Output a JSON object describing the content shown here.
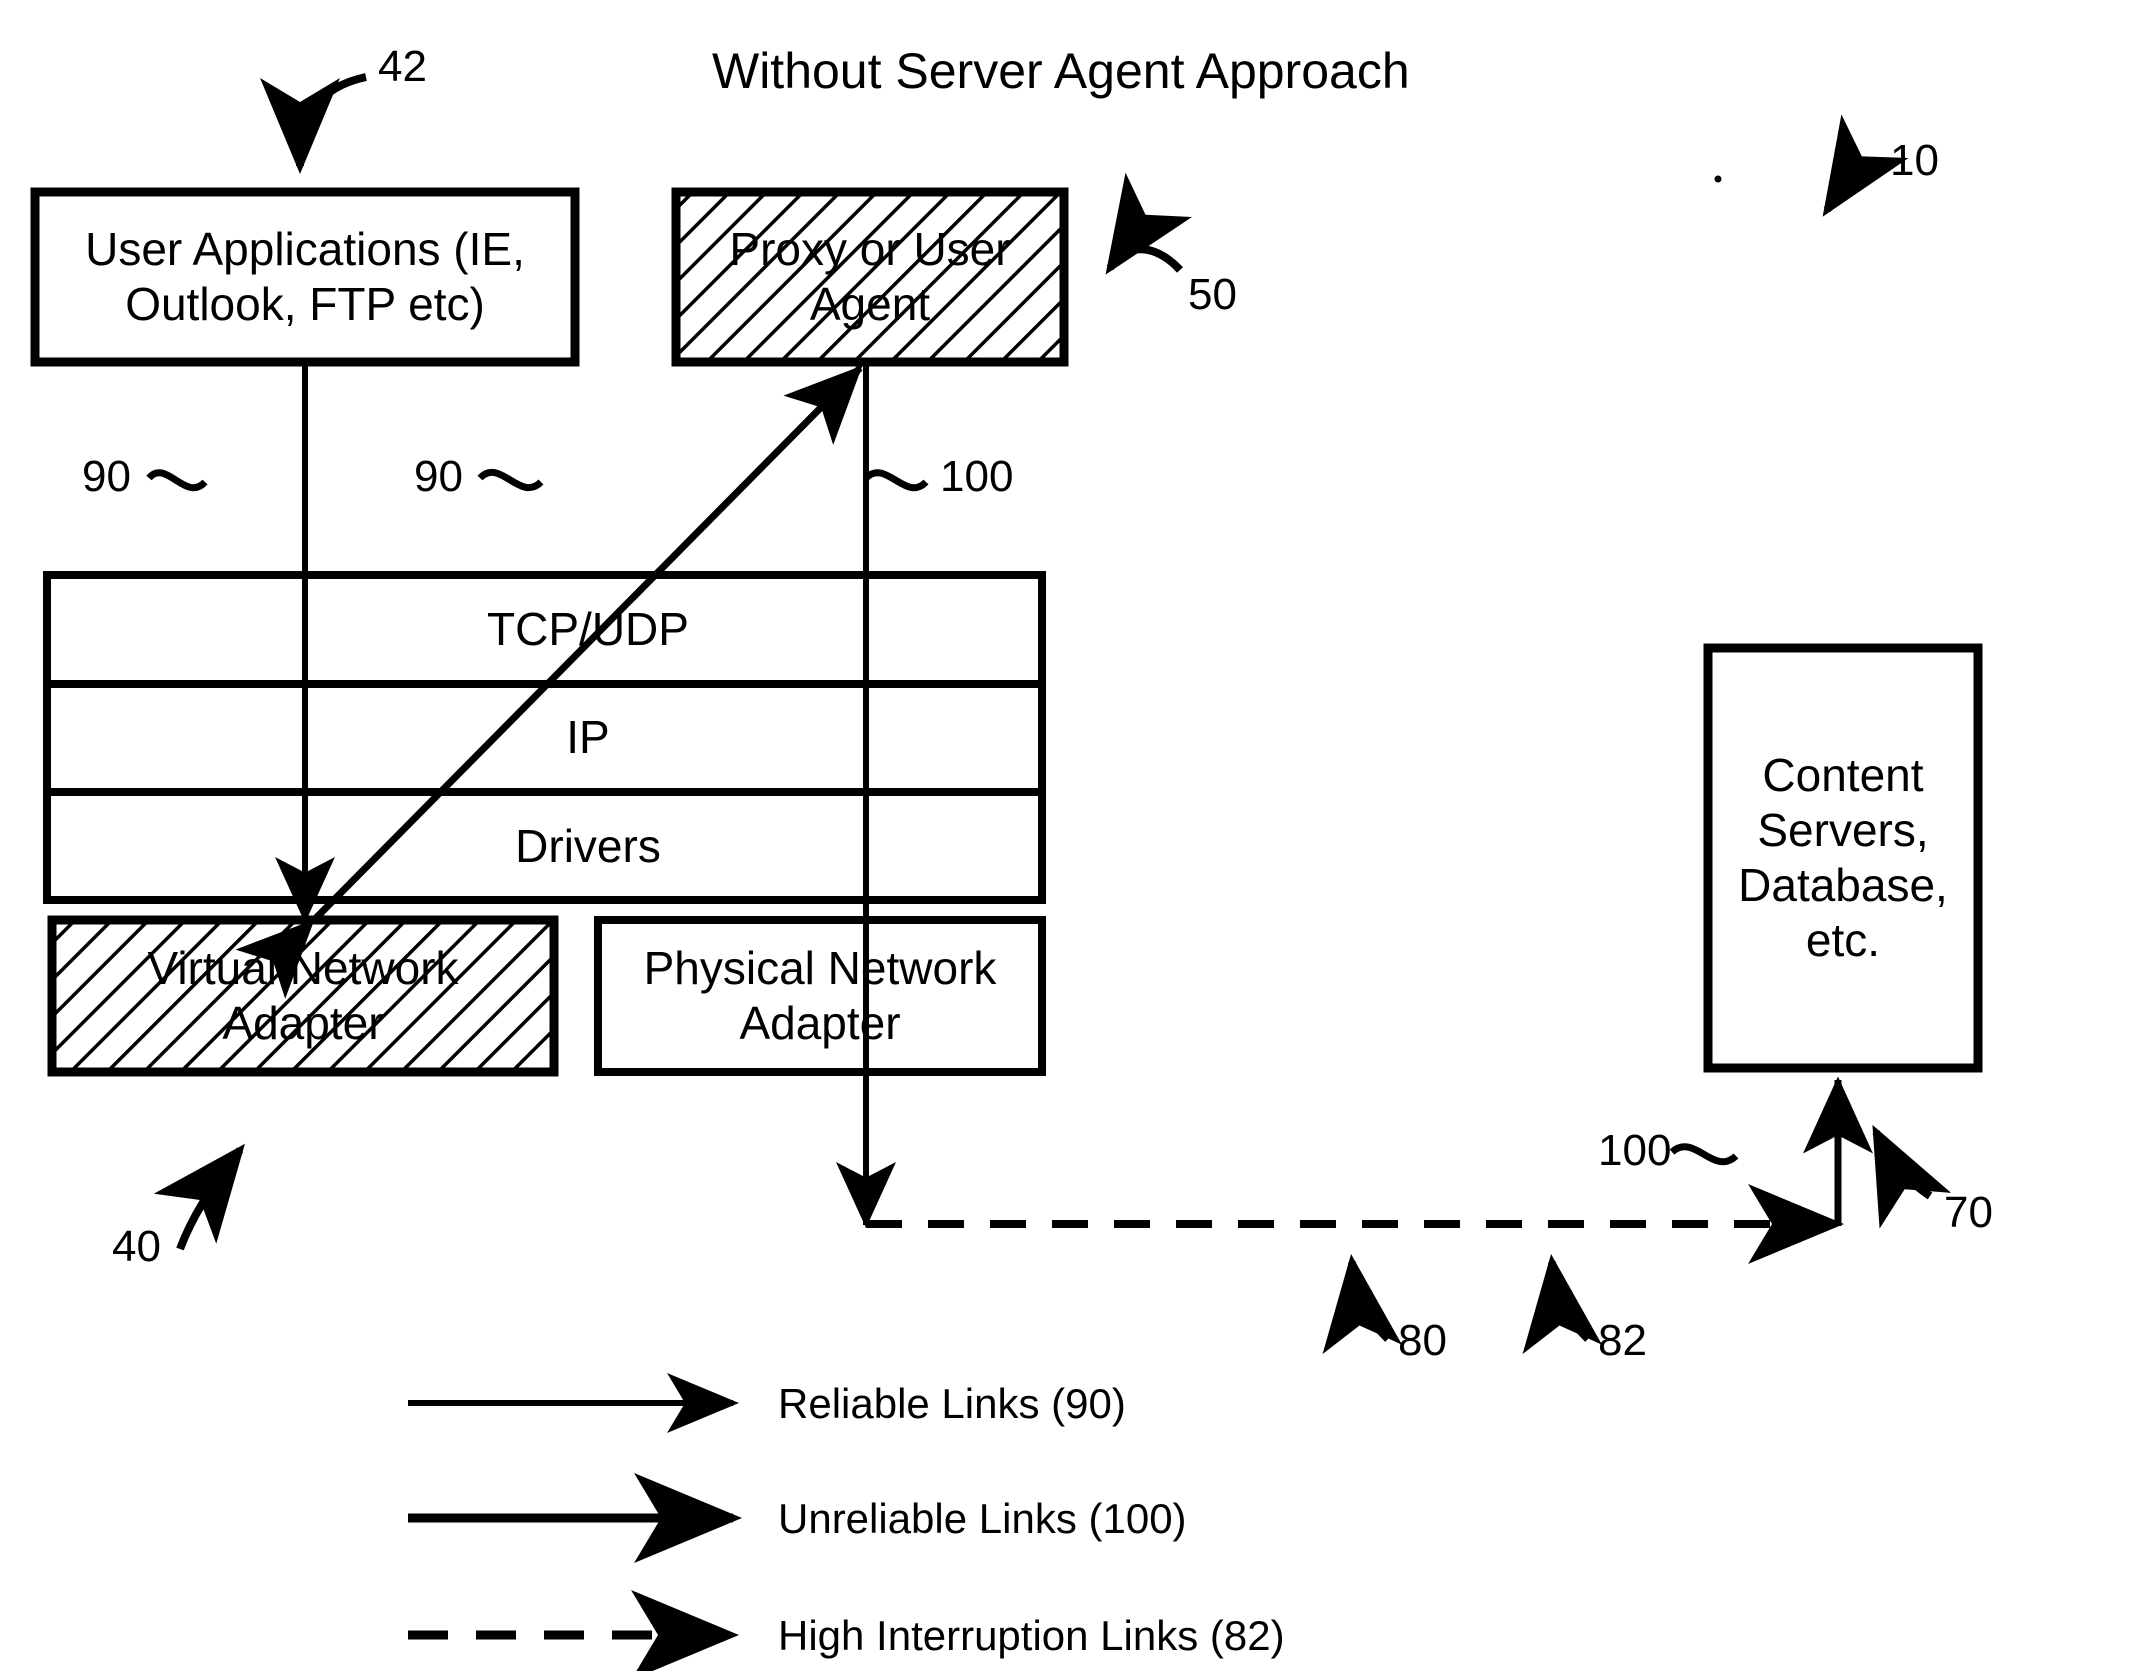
{
  "title": "Without Server Agent Approach",
  "boxes": {
    "user_applications": "User Applications (IE,\nOutlook, FTP etc)",
    "proxy_agent": "Proxy or User\nAgent",
    "tcp_udp": "TCP/UDP",
    "ip": "IP",
    "drivers": "Drivers",
    "virtual_network_adapter": "Virtual Network\nAdapter",
    "physical_network_adapter": "Physical Network\nAdapter",
    "content_servers": "Content\nServers,\nDatabase,\netc."
  },
  "ref_numbers": {
    "system": "10",
    "user_apps": "42",
    "client_stack": "40",
    "proxy": "50",
    "content_servers": "70",
    "link_80": "80",
    "link_82": "82",
    "reliable_left": "90",
    "reliable_mid": "90",
    "unreliable_top": "100",
    "unreliable_bottom": "100"
  },
  "legend": {
    "items": [
      {
        "label": "Reliable Links (90)",
        "style": "solid-thin",
        "icon": "arrow-right-icon"
      },
      {
        "label": "Unreliable Links (100)",
        "style": "solid-thick",
        "icon": "arrow-right-icon"
      },
      {
        "label": "High Interruption Links (82)",
        "style": "dashed",
        "icon": "arrow-right-icon"
      }
    ]
  },
  "colors": {
    "ink": "#000000",
    "paper": "#ffffff"
  }
}
